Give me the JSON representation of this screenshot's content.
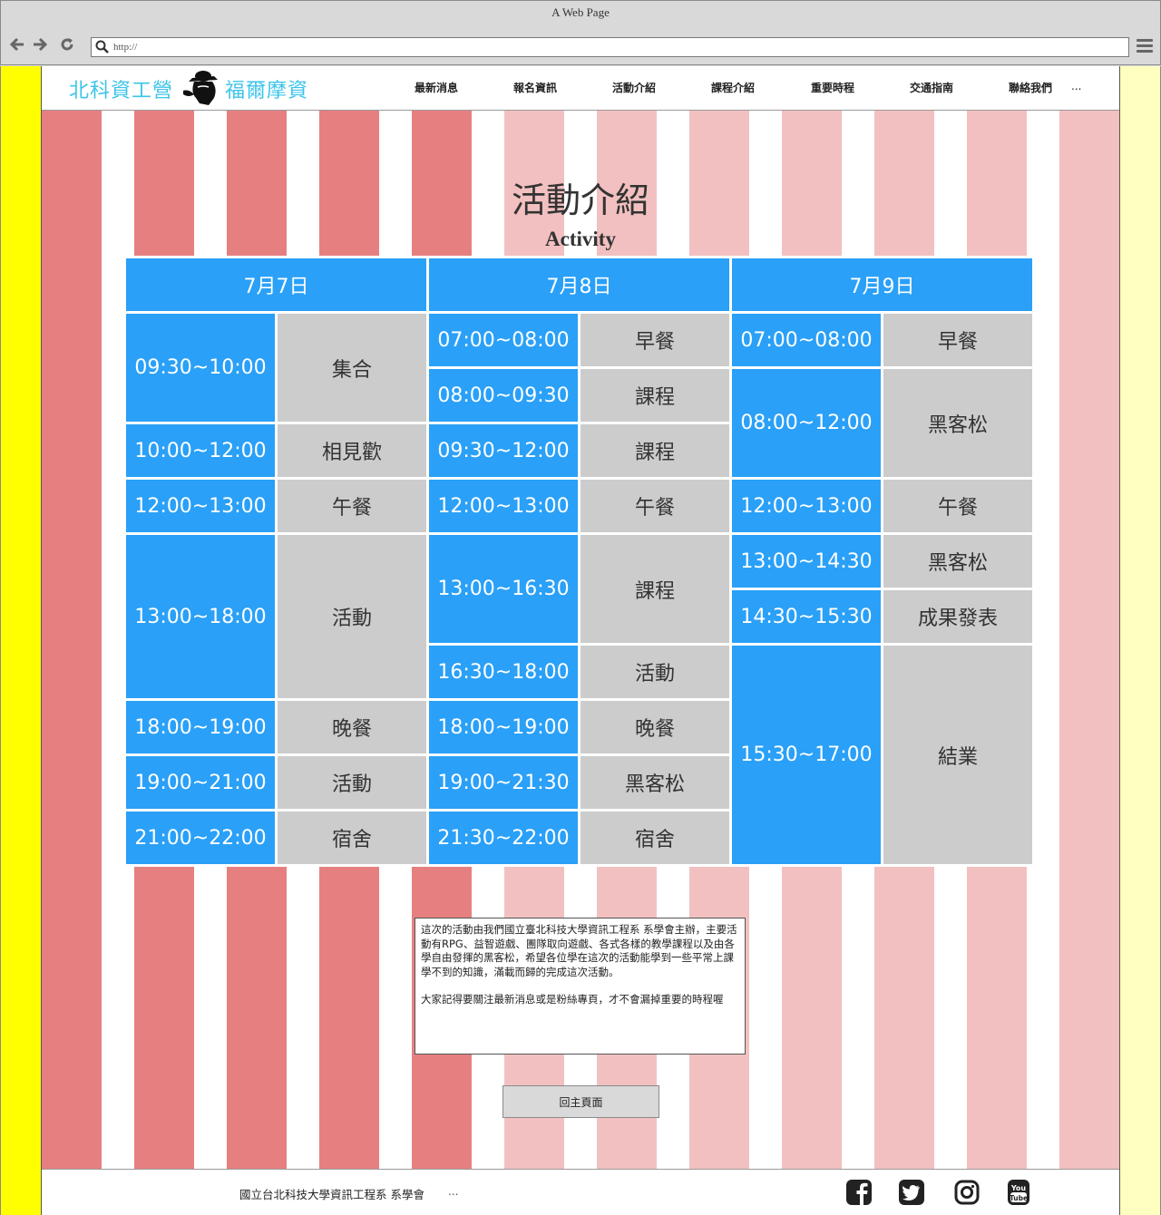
{
  "browser": {
    "window_title": "A Web Page",
    "url": "http://"
  },
  "header": {
    "logo_left": "北科資工營",
    "logo_right": "福爾摩資",
    "menu": [
      "最新消息",
      "報名資訊",
      "活動介紹",
      "課程介紹",
      "重要時程",
      "交通指南",
      "聯絡我們"
    ],
    "menu_more": "..."
  },
  "main": {
    "title": "活動介紹",
    "subtitle": "Activity"
  },
  "schedule": {
    "days": [
      "7月7日",
      "7月8日",
      "7月9日"
    ],
    "rows": [
      [
        "09:30~10:00",
        "集合",
        "07:00~08:00",
        "早餐",
        "07:00~08:00",
        "早餐"
      ],
      [
        "08:00~09:30",
        "課程",
        "08:00~12:00",
        "黑客松"
      ],
      [
        "10:00~12:00",
        "相見歡",
        "09:30~12:00",
        "課程"
      ],
      [
        "12:00~13:00",
        "午餐",
        "12:00~13:00",
        "午餐",
        "12:00~13:00",
        "午餐"
      ],
      [
        "13:00~18:00",
        "活動",
        "13:00~16:30",
        "課程",
        "13:00~14:30",
        "黑客松"
      ],
      [
        "14:30~15:30",
        "成果發表"
      ],
      [
        "16:30~18:00",
        "活動",
        "15:30~17:00",
        "結業"
      ],
      [
        "18:00~19:00",
        "晚餐",
        "18:00~19:00",
        "晚餐"
      ],
      [
        "19:00~21:00",
        "活動",
        "19:00~21:30",
        "黑客松"
      ],
      [
        "21:00~22:00",
        "宿舍",
        "21:30~22:00",
        "宿舍"
      ]
    ]
  },
  "description": {
    "p1": "這次的活動由我們國立臺北科技大學資訊工程系 系學會主辦，主要活動有RPG、益智遊戲、團隊取向遊戲、各式各樣的教學課程以及由各學自由發揮的黑客松，希望各位學在這次的活動能學到一些平常上課學不到的知識，滿載而歸的完成這次活動。",
    "p2": "大家記得要關注最新消息或是粉絲專頁，才不會漏掉重要的時程喔"
  },
  "back_button": "回主頁面",
  "footer": {
    "text": "國立台北科技大學資訊工程系 系學會",
    "more": "...",
    "social_icons": [
      "facebook-icon",
      "twitter-icon",
      "instagram-icon",
      "youtube-icon"
    ]
  },
  "colors": {
    "accent_blue": "#2aa0f8",
    "cell_gray": "#cccccc",
    "stripe_dark": "#e68080",
    "stripe_light": "#f2c0c0",
    "left_strip": "#ffff00",
    "right_strip": "#ffffc0",
    "logo": "#3cc4ea"
  }
}
